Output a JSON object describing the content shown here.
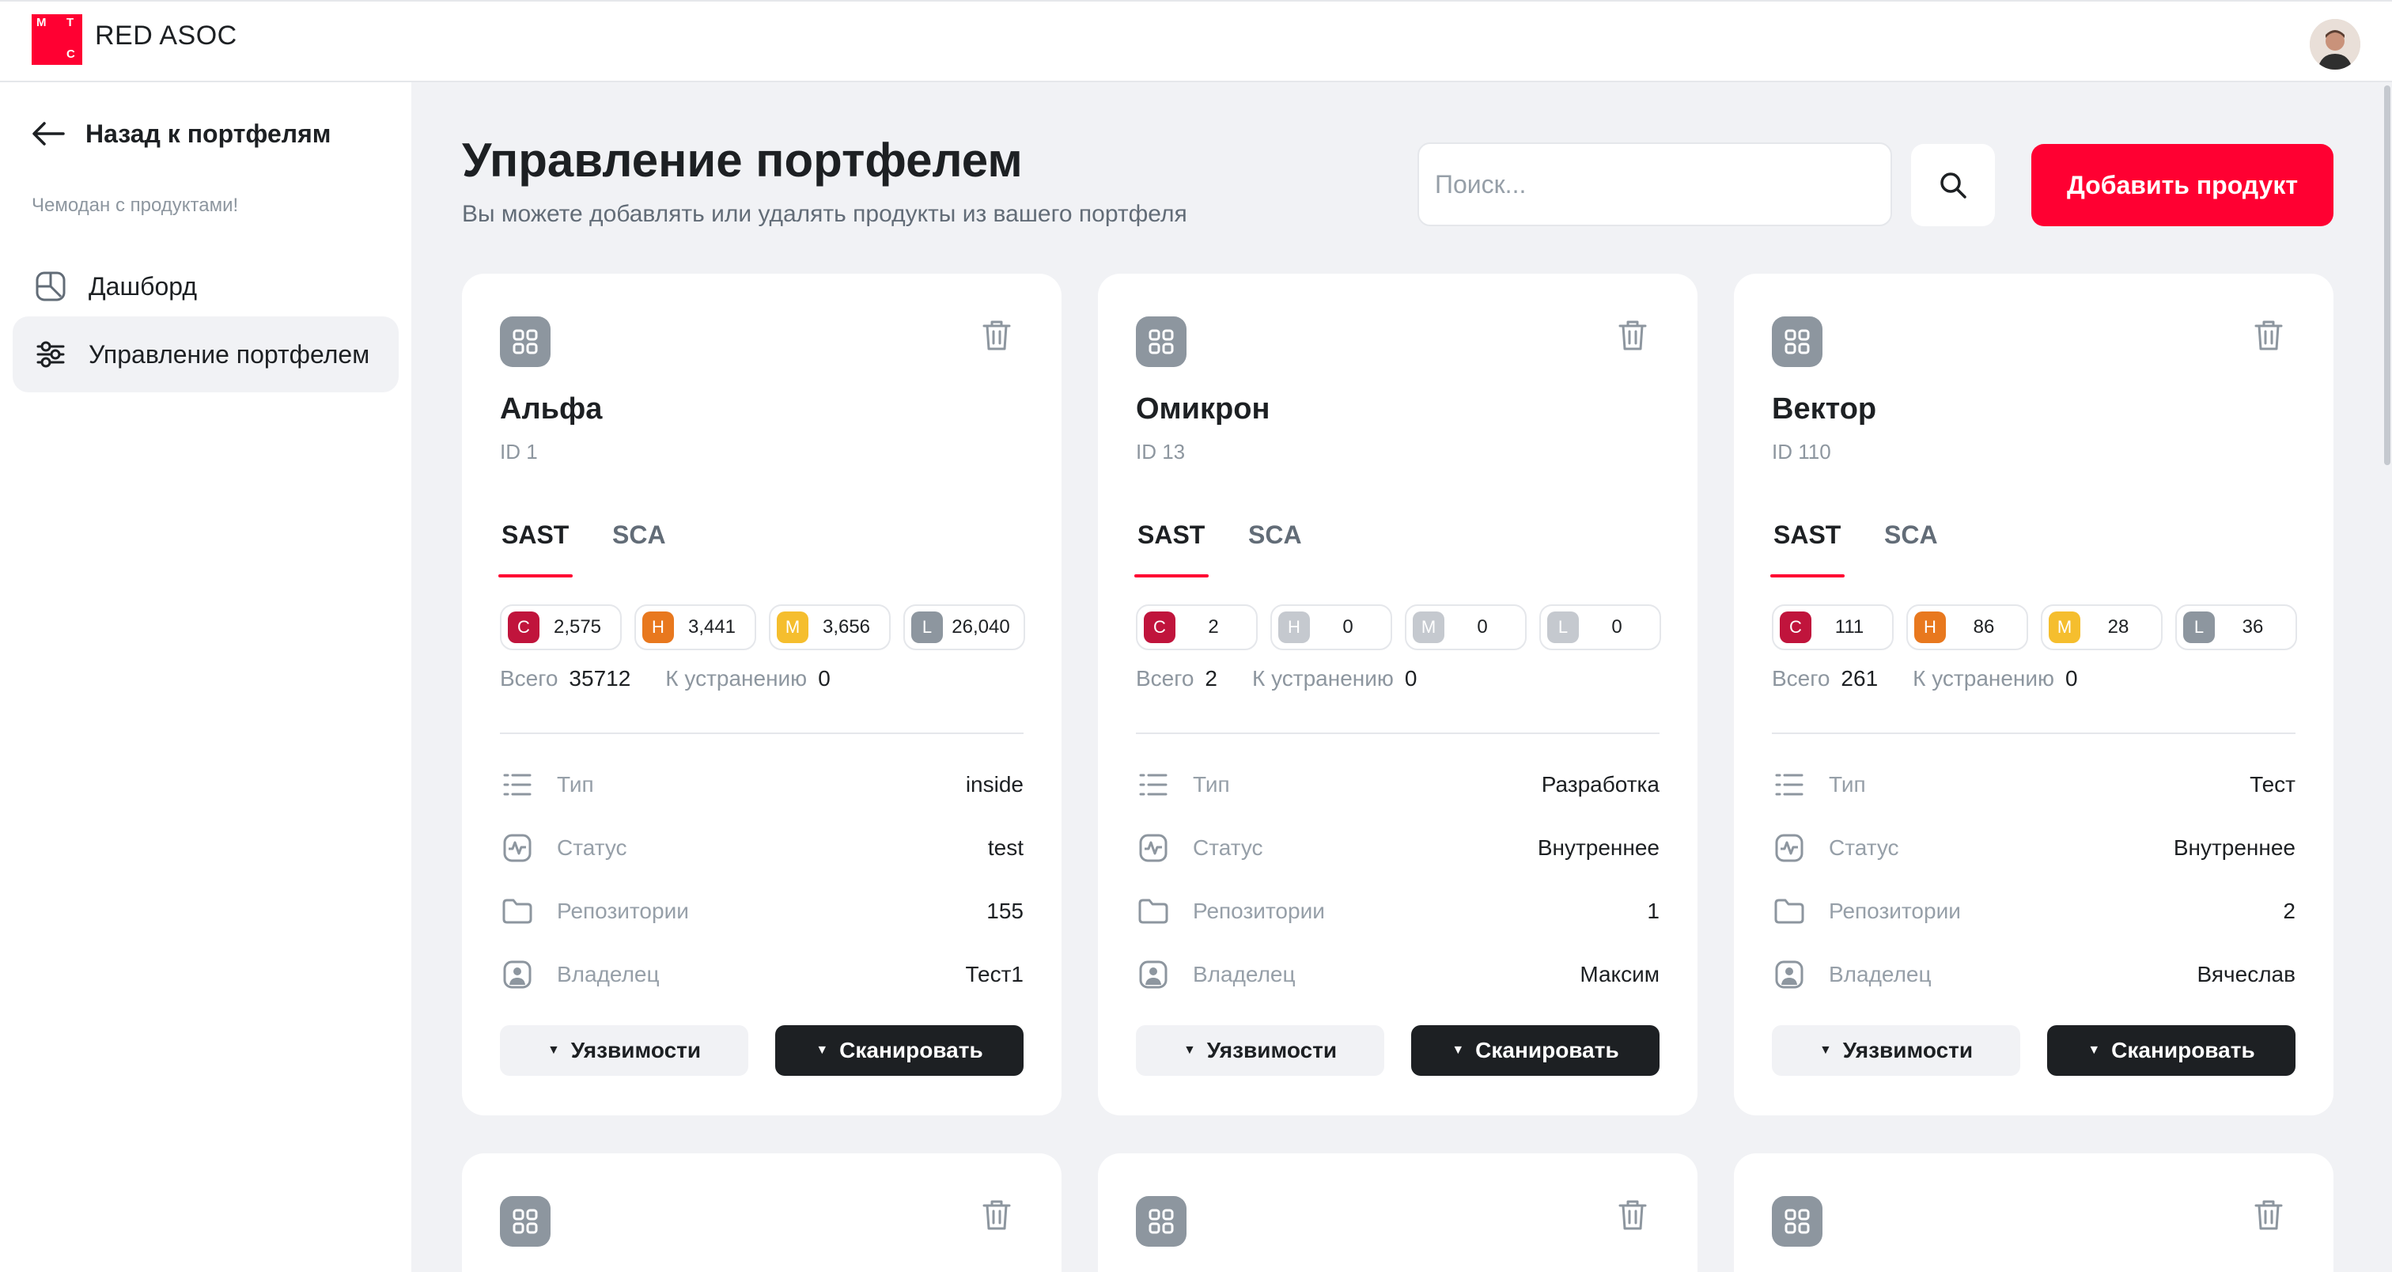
{
  "app": {
    "logo_letters": [
      "М",
      "Т",
      "С"
    ],
    "name": "RED ASOC"
  },
  "sidebar": {
    "back_label": "Назад к портфелям",
    "caption": "Чемодан с продуктами!",
    "items": [
      {
        "label": "Дашборд",
        "icon": "dashboard-icon",
        "active": false
      },
      {
        "label": "Управление портфелем",
        "icon": "sliders-icon",
        "active": true
      }
    ]
  },
  "main": {
    "title": "Управление портфелем",
    "subtitle": "Вы можете добавлять или удалять продукты из вашего портфеля",
    "search_placeholder": "Поиск...",
    "add_button": "Добавить продукт"
  },
  "colors": {
    "accent": "#ff0032",
    "critical": "#c0143c",
    "high": "#e8781e",
    "medium": "#f5be2e",
    "low": "#8d969f",
    "dark": "#1d2023"
  },
  "labels": {
    "tab_sast": "SAST",
    "tab_sca": "SCA",
    "total": "Всего",
    "to_fix": "К устранению",
    "type": "Тип",
    "status": "Статус",
    "repos": "Репозитории",
    "owner": "Владелец",
    "vuln_button": "Уязвимости",
    "scan_button": "Сканировать",
    "sev_c": "C",
    "sev_h": "H",
    "sev_m": "M",
    "sev_l": "L"
  },
  "products": [
    {
      "name": "Альфа",
      "id": "ID 1",
      "c": "2,575",
      "h": "3,441",
      "m": "3,656",
      "l": "26,040",
      "total": "35712",
      "to_fix": "0",
      "type": "inside",
      "status": "test",
      "repos": "155",
      "owner": "Тест1"
    },
    {
      "name": "Омикрон",
      "id": "ID 13",
      "c": "2",
      "h": "0",
      "m": "0",
      "l": "0",
      "total": "2",
      "to_fix": "0",
      "type": "Разработка",
      "status": "Внутреннее",
      "repos": "1",
      "owner": "Максим"
    },
    {
      "name": "Вектор",
      "id": "ID 110",
      "c": "111",
      "h": "86",
      "m": "28",
      "l": "36",
      "total": "261",
      "to_fix": "0",
      "type": "Тест",
      "status": "Внутреннее",
      "repos": "2",
      "owner": "Вячеслав"
    }
  ]
}
